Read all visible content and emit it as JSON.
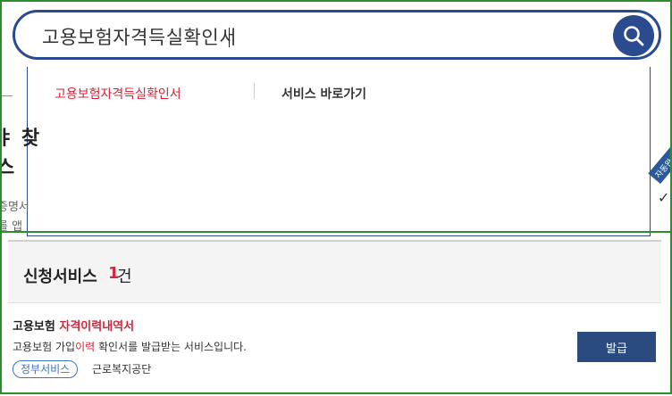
{
  "search": {
    "value": "고용보험자격득실확인서"
  },
  "suggest": {
    "item": "고용보험자격득실확인서",
    "shortcut_label": "서비스 바로가기"
  },
  "background": {
    "stub_big_1": "ㅑ 찾",
    "stub_big_2": "스",
    "stub_small_1": "증명서",
    "stub_small_2": "를 앱",
    "badge": "자동완성",
    "glyph": "✓"
  },
  "results": {
    "title": "신청서비스",
    "count": "1",
    "unit": "건",
    "service": {
      "title_pre": "고용보험 ",
      "title_hl": "자격이력내역서",
      "desc_pre": "고용보험 가입",
      "desc_hl": "이력",
      "desc_post": " 확인서를 발급받는 서비스입니다.",
      "tag": "정부서비스",
      "org": "근로복지공단",
      "button": "발급"
    }
  },
  "colors": {
    "primary": "#2b4a8f",
    "highlight": "#d1253b",
    "frame": "#2e8b2e"
  }
}
